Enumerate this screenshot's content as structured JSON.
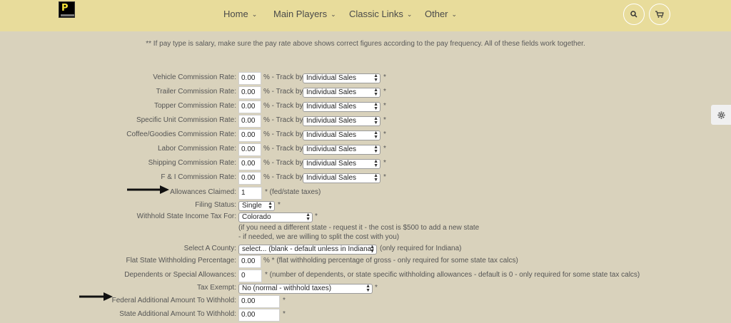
{
  "nav": {
    "items": [
      {
        "label": "Home"
      },
      {
        "label": "Main Players"
      },
      {
        "label": "Classic Links"
      },
      {
        "label": "Other"
      }
    ]
  },
  "notice": "** If pay type is salary, make sure the pay rate above shows correct figures according to the pay frequency. All of these fields work together.",
  "commission_rows": [
    {
      "label": "Vehicle Commission Rate:",
      "value": "0.00",
      "track_text": "% - Track by:",
      "select": "Individual Sales",
      "star": "*"
    },
    {
      "label": "Trailer Commission Rate:",
      "value": "0.00",
      "track_text": "% - Track by:",
      "select": "Individual Sales",
      "star": "*"
    },
    {
      "label": "Topper Commission Rate:",
      "value": "0.00",
      "track_text": "% - Track by:",
      "select": "Individual Sales",
      "star": "*"
    },
    {
      "label": "Specific Unit Commission Rate:",
      "value": "0.00",
      "track_text": "% - Track by:",
      "select": "Individual Sales",
      "star": "*"
    },
    {
      "label": "Coffee/Goodies Commission Rate:",
      "value": "0.00",
      "track_text": "% - Track by:",
      "select": "Individual Sales",
      "star": "*"
    },
    {
      "label": "Labor Commission Rate:",
      "value": "0.00",
      "track_text": "% - Track by:",
      "select": "Individual Sales",
      "star": "*"
    },
    {
      "label": "Shipping Commission Rate:",
      "value": "0.00",
      "track_text": "% - Track by:",
      "select": "Individual Sales",
      "star": "*"
    },
    {
      "label": "F & I Commission Rate:",
      "value": "0.00",
      "track_text": "% - Track by:",
      "select": "Individual Sales",
      "star": "*"
    }
  ],
  "allowances": {
    "label": "Allowances Claimed:",
    "value": "1",
    "note": "* (fed/state taxes)"
  },
  "filing_status": {
    "label": "Filing Status:",
    "select": "Single",
    "star": "*"
  },
  "withhold_state": {
    "label": "Withhold State Income Tax For:",
    "select": "Colorado",
    "star": "*",
    "note1": "(if you need a different state - request it - the cost is $500 to add a new state",
    "note2": "- if needed, we are willing to split the cost with you)"
  },
  "county": {
    "label": "Select A County:",
    "select": "select... (blank - default unless in Indiana)",
    "note": "(only required for Indiana)"
  },
  "flat_state": {
    "label": "Flat State Withholding Percentage:",
    "value": "0.00",
    "note": "% * (flat withholding percentage of gross - only required for some state tax calcs)"
  },
  "dependents": {
    "label": "Dependents or Special Allowances:",
    "value": "0",
    "note": "* (number of dependents, or state specific withholding allowances - default is 0 - only required for some state tax calcs)"
  },
  "tax_exempt": {
    "label": "Tax Exempt:",
    "select": "No (normal - withhold taxes)",
    "star": "*"
  },
  "federal_additional": {
    "label": "Federal Additional Amount To Withhold:",
    "value": "0.00",
    "star": "*"
  },
  "state_additional": {
    "label": "State Additional Amount To Withhold:",
    "value": "0.00",
    "star": "*"
  },
  "colors": {
    "header": "#e8dc9b",
    "background": "#d9d2bc"
  }
}
